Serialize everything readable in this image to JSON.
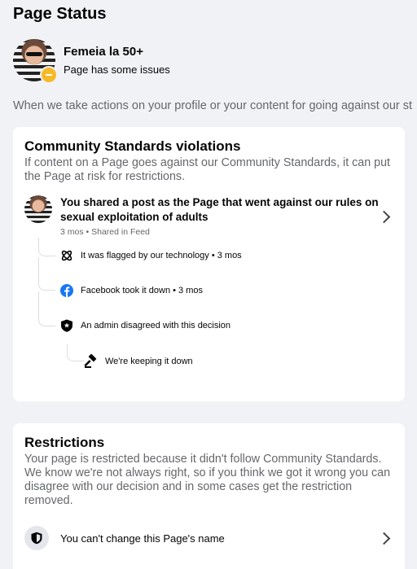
{
  "page": {
    "title": "Page Status",
    "intro": "When we take actions on your profile or your content for going against our st"
  },
  "profile": {
    "name": "Femeia la 50+",
    "status": "Page has some issues",
    "status_color": "#f7b928"
  },
  "community": {
    "title": "Community Standards violations",
    "description": "If content on a Page goes against our Community Standards, it can put the Page at risk for restrictions.",
    "post": {
      "title": "You shared a post as the Page that went against our rules on sexual exploitation of adults",
      "meta": "3 mos • Shared in Feed"
    },
    "timeline": [
      {
        "icon": "technology-icon",
        "text": "It was flagged by our technology • 3 mos"
      },
      {
        "icon": "facebook-icon",
        "text": "Facebook took it down • 3 mos"
      },
      {
        "icon": "admin-shield-icon",
        "text": "An admin disagreed with this decision"
      },
      {
        "icon": "gavel-icon",
        "text": "We're keeping it down"
      }
    ]
  },
  "restrictions": {
    "title": "Restrictions",
    "description": "Your page is restricted because it didn't follow Community Standards. We know we're not always right, so if you think we got it wrong you can disagree with our decision and in some cases get the restriction removed.",
    "item_label": "You can't change this Page's name"
  },
  "colors": {
    "facebook_blue": "#1877f2",
    "secondary_text": "#65676b",
    "background": "#f0f2f5"
  }
}
